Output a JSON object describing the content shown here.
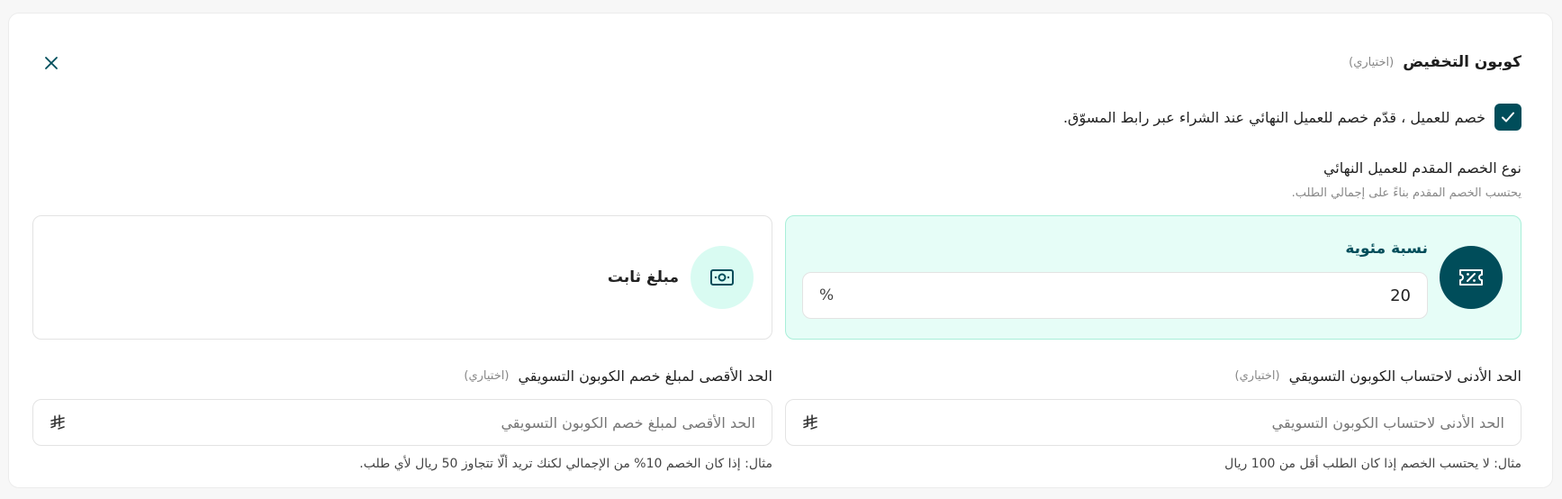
{
  "header": {
    "title": "كوبون التخفيض",
    "optional": "(اختياري)",
    "close_icon": "close-icon"
  },
  "checkbox": {
    "checked": true,
    "label": "خصم للعميل ، قدّم خصم للعميل النهائي عند الشراء عبر رابط المسوّق."
  },
  "discount_type": {
    "title": "نوع الخصم المقدم للعميل النهائي",
    "subtitle": "يحتسب الخصم المقدم بناءً على إجمالي الطلب.",
    "options": [
      {
        "label": "نسبة مئوية",
        "icon": "percentage-ticket-icon",
        "selected": true,
        "value": "20",
        "unit": "%"
      },
      {
        "label": "مبلغ ثابت",
        "icon": "banknote-icon",
        "selected": false
      }
    ]
  },
  "min_field": {
    "label": "الحد الأدنى لاحتساب الكوبون التسويقي",
    "optional": "(اختياري)",
    "placeholder": "الحد الأدنى لاحتساب الكوبون التسويقي",
    "currency_icon": "riyal-icon",
    "hint": "مثال: لا يحتسب الخصم إذا كان الطلب أقل من 100 ريال"
  },
  "max_field": {
    "label": "الحد الأقصى لمبلغ خصم الكوبون التسويقي",
    "optional": "(اختياري)",
    "placeholder": "الحد الأقصى لمبلغ خصم الكوبون التسويقي",
    "currency_icon": "riyal-icon",
    "hint": "مثال: إذا كان الخصم 10% من الإجمالي لكنك تريد ألّا تتجاوز 50 ريال لأي طلب."
  },
  "colors": {
    "primary": "#004d5a",
    "selected_bg": "#e6fdf7",
    "selected_border": "#a9efd9",
    "icon_light_bg": "#d9fbf2"
  }
}
